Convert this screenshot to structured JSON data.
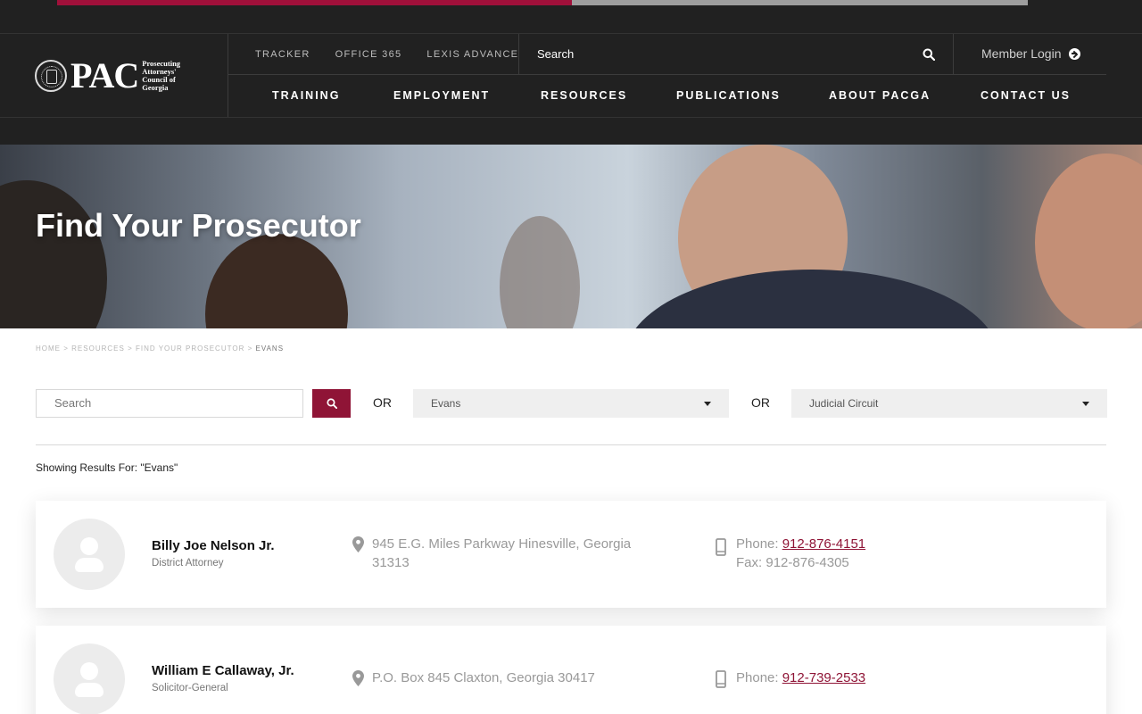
{
  "colors": {
    "accent": "#8f1436",
    "header_bg": "#212121",
    "progress_fill": "#a0103a"
  },
  "progress": {
    "percent": 53
  },
  "logo": {
    "text": "PAC",
    "subtitle": "Prosecuting Attorneys' Council of Georgia"
  },
  "utility_nav": [
    {
      "label": "TRACKER"
    },
    {
      "label": "OFFICE 365"
    },
    {
      "label": "LEXIS ADVANCE"
    }
  ],
  "header_search": {
    "placeholder": "Search",
    "icon": "search-icon"
  },
  "member_login": {
    "label": "Member Login",
    "icon": "arrow-circle-right-icon"
  },
  "main_nav": [
    {
      "label": "TRAINING"
    },
    {
      "label": "EMPLOYMENT"
    },
    {
      "label": "RESOURCES"
    },
    {
      "label": "PUBLICATIONS"
    },
    {
      "label": "ABOUT PACGA"
    },
    {
      "label": "CONTACT US"
    }
  ],
  "hero": {
    "title": "Find Your Prosecutor"
  },
  "breadcrumb": {
    "items": [
      "HOME",
      "RESOURCES",
      "FIND YOUR PROSECUTOR"
    ],
    "separator": ">",
    "current": "EVANS"
  },
  "filters": {
    "search_placeholder": "Search",
    "or_label": "OR",
    "county_value": "Evans",
    "circuit_value": "Judicial Circuit"
  },
  "results": {
    "label": "Showing Results For: \"Evans\"",
    "items": [
      {
        "name": "Billy Joe Nelson Jr.",
        "role": "District Attorney",
        "address": "945 E.G. Miles Parkway Hinesville, Georgia 31313",
        "phone_label": "Phone:",
        "phone": "912-876-4151",
        "fax_label": "Fax:",
        "fax": "912-876-4305"
      },
      {
        "name": "William E Callaway, Jr.",
        "role": "Solicitor-General",
        "address": "P.O. Box 845 Claxton, Georgia 30417",
        "phone_label": "Phone:",
        "phone": "912-739-2533"
      }
    ]
  }
}
